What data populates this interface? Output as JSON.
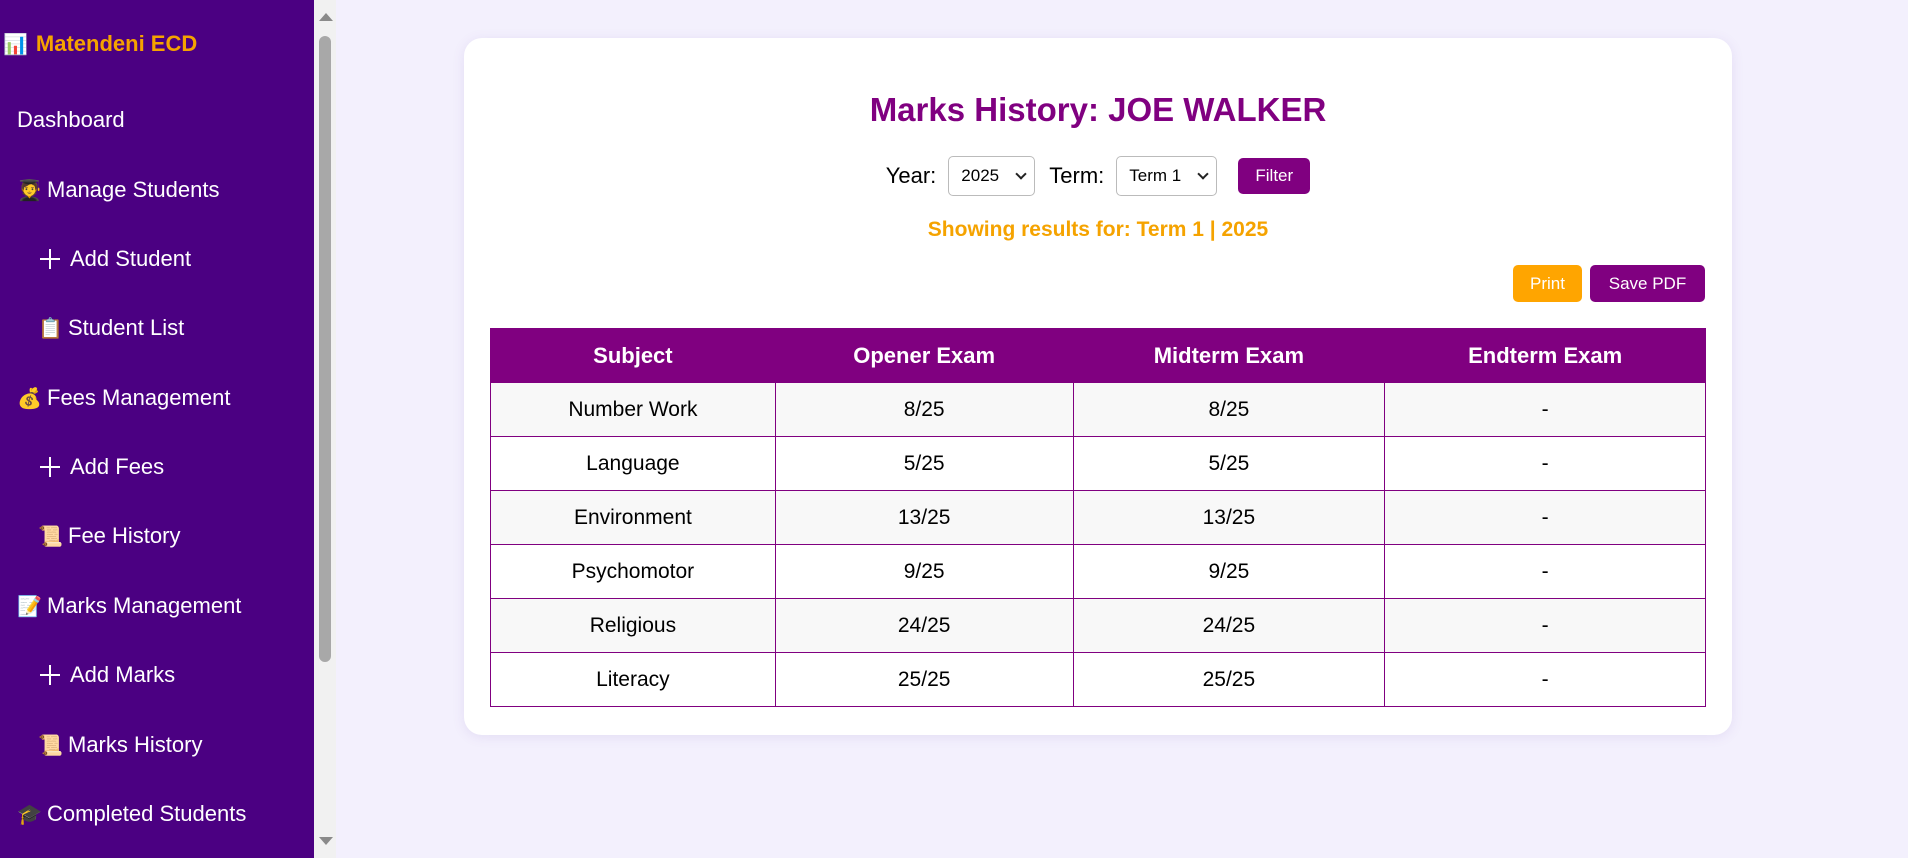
{
  "sidebar": {
    "brand": {
      "icon": "chart-icon",
      "glyph": "📊",
      "label": "Matendeni ECD"
    },
    "items": [
      {
        "label": "Dashboard",
        "glyph": ""
      },
      {
        "label": "Manage Students",
        "glyph": "🧑‍🎓",
        "icon": "student-icon"
      },
      {
        "label": "Add Student",
        "icon": "plus-icon"
      },
      {
        "label": "Student List",
        "glyph": "📋",
        "icon": "clipboard-icon"
      },
      {
        "label": "Fees Management",
        "glyph": "💰",
        "icon": "money-bag-icon"
      },
      {
        "label": "Add Fees",
        "icon": "plus-icon"
      },
      {
        "label": "Fee History",
        "glyph": "📜",
        "icon": "scroll-icon"
      },
      {
        "label": "Marks Management",
        "glyph": "📝",
        "icon": "memo-icon"
      },
      {
        "label": "Add Marks",
        "icon": "plus-icon"
      },
      {
        "label": "Marks History",
        "glyph": "📜",
        "icon": "scroll-icon"
      },
      {
        "label": "Completed Students",
        "glyph": "🎓",
        "icon": "graduation-cap-icon"
      }
    ]
  },
  "main": {
    "title": "Marks History: JOE WALKER",
    "filter": {
      "year_label": "Year:",
      "year_value": "2025",
      "term_label": "Term:",
      "term_value": "Term 1",
      "button": "Filter"
    },
    "results_text": "Showing results for: Term 1 | 2025",
    "print_button": "Print",
    "pdf_button": "Save PDF",
    "table": {
      "headers": [
        "Subject",
        "Opener Exam",
        "Midterm Exam",
        "Endterm Exam"
      ],
      "rows": [
        [
          "Number Work",
          "8/25",
          "8/25",
          "-"
        ],
        [
          "Language",
          "5/25",
          "5/25",
          "-"
        ],
        [
          "Environment",
          "13/25",
          "13/25",
          "-"
        ],
        [
          "Psychomotor",
          "9/25",
          "9/25",
          "-"
        ],
        [
          "Religious",
          "24/25",
          "24/25",
          "-"
        ],
        [
          "Literacy",
          "25/25",
          "25/25",
          "-"
        ]
      ]
    }
  },
  "colors": {
    "sidebar_bg": "#4b0082",
    "accent_purple": "#800080",
    "accent_orange": "#ffa500",
    "page_bg": "#f3f0fd"
  }
}
